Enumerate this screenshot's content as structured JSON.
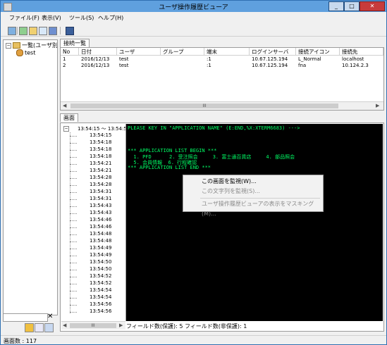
{
  "window": {
    "title": "ユーザ操作履歴ビューア",
    "min_label": "_",
    "max_label": "□",
    "close_label": "✕"
  },
  "menu": [
    "ファイル(F)",
    "表示(V)",
    "ツール(S)",
    "ヘルプ(H)"
  ],
  "toolbar": {
    "icons": [
      "refresh-icon",
      "export-icon",
      "import-icon",
      "window-icon",
      "settings-icon",
      "binoculars-icon"
    ]
  },
  "left": {
    "root_label": "一覧(ユーザ別)",
    "user_label": "test",
    "expander": "−",
    "clear_label": "✕"
  },
  "connections": {
    "tab_label": "接続一覧",
    "columns": [
      "No",
      "日付",
      "ユーザ",
      "グループ",
      "端末",
      "ログインサーバ",
      "接続アイコン",
      "接続先"
    ],
    "rows": [
      [
        "1",
        "2016/12/13",
        "test",
        "",
        ":1",
        "10.67.125.194",
        "L_Normal",
        "localhost"
      ],
      [
        "2",
        "2016/12/13",
        "test",
        "",
        ":1",
        "10.67.125.194",
        "fna",
        "10.124.2.3"
      ]
    ],
    "scroll_glyph": "III"
  },
  "screen": {
    "tab_label": "画面",
    "time_root": "13:54:15 ～ 13:54:56",
    "times": [
      "13:54:15",
      "13:54:18",
      "13:54:18",
      "13:54:18",
      "13:54:21",
      "13:54:21",
      "13:54:28",
      "13:54:28",
      "13:54:31",
      "13:54:31",
      "13:54:43",
      "13:54:43",
      "13:54:46",
      "13:54:46",
      "13:54:48",
      "13:54:48",
      "13:54:49",
      "13:54:49",
      "13:54:50",
      "13:54:50",
      "13:54:52",
      "13:54:52",
      "13:54:54",
      "13:54:54",
      "13:54:56",
      "13:54:56"
    ],
    "terminal_lines": [
      "PLEASE KEY IN \"APPLICATION NAME\" (E:END,%X:XTERM6683) --->",
      "",
      "",
      "",
      "*** APPLICATION LIST BEGIN ***",
      "  1. PFD      2. 受注照会     3. 富士通百貨店     4. 部品照会",
      "  5. 会員情報  6. 行程確認",
      "*** APPLICATION LIST END ***"
    ],
    "field_status": "フィールド数(保護): 5  フィールド数(非保護): 1",
    "scroll_glyph": "III"
  },
  "context_menu": {
    "items": [
      {
        "label": "この画面を監視(W)...",
        "enabled": true
      },
      {
        "label": "この文字列を監視(S)...",
        "enabled": false
      },
      {
        "label": "ユーザ操作履歴ビューアの表示をマスキング(M)...",
        "enabled": false
      }
    ]
  },
  "statusbar": {
    "text": "画面数 : 117"
  },
  "colors": {
    "titlebar": "#5fa0de",
    "terminal_bg": "#000000",
    "terminal_fg": "#00ff66"
  }
}
